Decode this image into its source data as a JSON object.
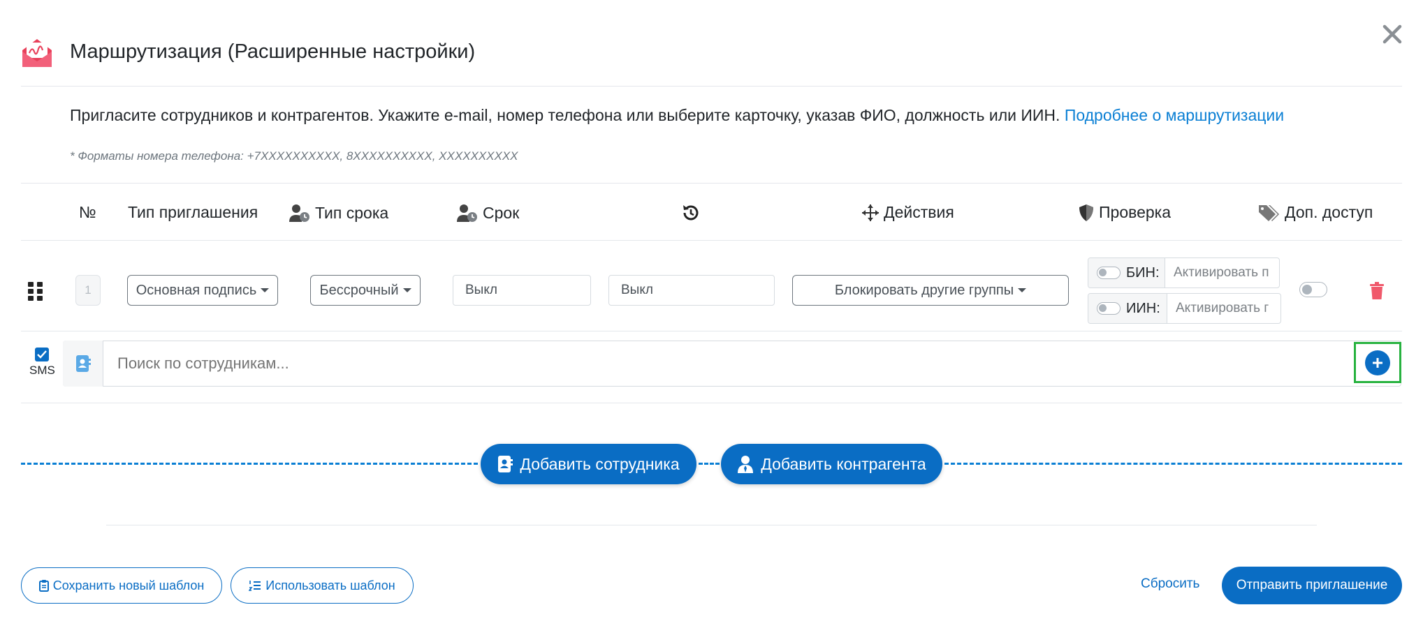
{
  "header": {
    "title": "Маршрутизация (Расширенные настройки)",
    "close_icon": "close-icon"
  },
  "intro": {
    "text": "Пригласите сотрудников и контрагентов. Укажите e-mail, номер телефона или выберите карточку, указав ФИО, должность или ИИН.",
    "link": "Подробнее о маршрутизации",
    "note": "* Форматы номера телефона: +7XXXXXXXXXX, 8XXXXXXXXXX, XXXXXXXXXX"
  },
  "columns": {
    "num": "№",
    "invite_type": "Тип приглашения",
    "term_type": "Тип срока",
    "term": "Срок",
    "actions": "Действия",
    "check": "Проверка",
    "extra_access": "Доп. доступ"
  },
  "row": {
    "number": "1",
    "invite_type": "Основная подпись",
    "term_type": "Бессрочный",
    "term": "Выкл",
    "history": "Выкл",
    "action": "Блокировать другие группы",
    "bin_label": "БИН:",
    "bin_placeholder": "Активировать п",
    "iin_label": "ИИН:",
    "iin_placeholder": "Активировать г"
  },
  "search": {
    "sms_label": "SMS",
    "placeholder": "Поиск по сотрудникам..."
  },
  "add_buttons": {
    "employee": "Добавить сотрудника",
    "counterparty": "Добавить контрагента"
  },
  "footer": {
    "save_template": "Сохранить новый шаблон",
    "use_template": "Использовать шаблон",
    "reset": "Сбросить",
    "send": "Отправить приглашение"
  },
  "colors": {
    "accent": "#0a6dc4",
    "link": "#0a7fd4",
    "delete": "#f0596b",
    "highlight": "#27b23f"
  }
}
